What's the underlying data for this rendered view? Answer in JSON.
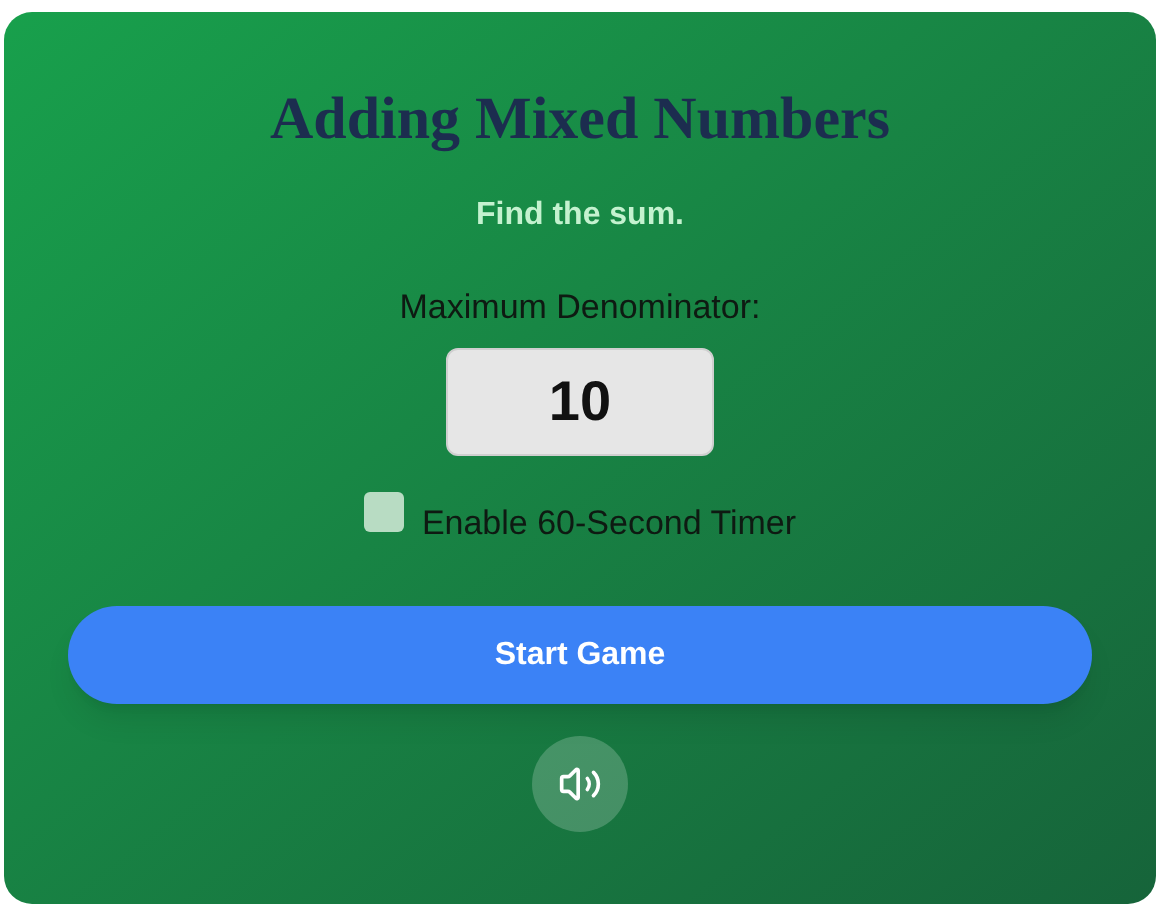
{
  "title": "Adding Mixed Numbers",
  "subtitle": "Find the sum.",
  "denominator": {
    "label": "Maximum Denominator:",
    "value": "10"
  },
  "timer": {
    "label": "Enable 60-Second Timer",
    "checked": false
  },
  "start_button": {
    "label": "Start Game"
  },
  "sound": {
    "on": true
  }
}
